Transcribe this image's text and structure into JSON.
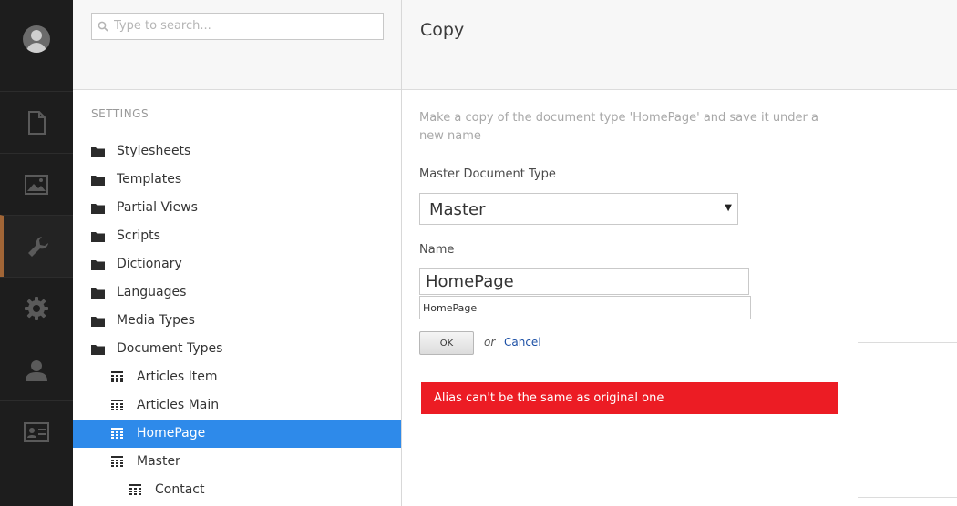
{
  "colors": {
    "rail_bg": "#1d1d1d",
    "active_accent": "#a16536",
    "selected_row": "#2e8aea",
    "alert_bg": "#ec1c24",
    "link": "#1b4fa5"
  },
  "rail": {
    "items": [
      {
        "icon": "document-icon",
        "active": false
      },
      {
        "icon": "image-icon",
        "active": false
      },
      {
        "icon": "wrench-icon",
        "active": true
      },
      {
        "icon": "gear-icon",
        "active": false
      },
      {
        "icon": "user-icon",
        "active": false
      },
      {
        "icon": "member-card-icon",
        "active": false
      }
    ]
  },
  "tree": {
    "search_placeholder": "Type to search...",
    "section_title": "SETTINGS",
    "items": [
      {
        "label": "Stylesheets",
        "icon": "folder-icon",
        "level": 0,
        "selected": false
      },
      {
        "label": "Templates",
        "icon": "folder-icon",
        "level": 0,
        "selected": false
      },
      {
        "label": "Partial Views",
        "icon": "folder-icon",
        "level": 0,
        "selected": false
      },
      {
        "label": "Scripts",
        "icon": "folder-icon",
        "level": 0,
        "selected": false
      },
      {
        "label": "Dictionary",
        "icon": "folder-icon",
        "level": 0,
        "selected": false
      },
      {
        "label": "Languages",
        "icon": "folder-icon",
        "level": 0,
        "selected": false
      },
      {
        "label": "Media Types",
        "icon": "folder-icon",
        "level": 0,
        "selected": false
      },
      {
        "label": "Document Types",
        "icon": "folder-icon",
        "level": 0,
        "selected": false
      },
      {
        "label": "Articles Item",
        "icon": "doctype-grid-icon",
        "level": 1,
        "selected": false
      },
      {
        "label": "Articles Main",
        "icon": "doctype-grid-icon",
        "level": 1,
        "selected": false
      },
      {
        "label": "HomePage",
        "icon": "doctype-grid-icon",
        "level": 1,
        "selected": true
      },
      {
        "label": "Master",
        "icon": "doctype-grid-icon",
        "level": 1,
        "selected": false
      },
      {
        "label": "Contact",
        "icon": "doctype-grid-icon",
        "level": 2,
        "selected": false
      }
    ]
  },
  "dialog": {
    "title": "Copy",
    "description": "Make a copy of the document type 'HomePage' and save it under a new name",
    "master_label": "Master Document Type",
    "master_value": "Master",
    "name_label": "Name",
    "name_value": "HomePage",
    "alias_value": "HomePage",
    "ok_label": "OK",
    "or_text": "or",
    "cancel_label": "Cancel",
    "error_text": "Alias can't be the same as original one"
  }
}
